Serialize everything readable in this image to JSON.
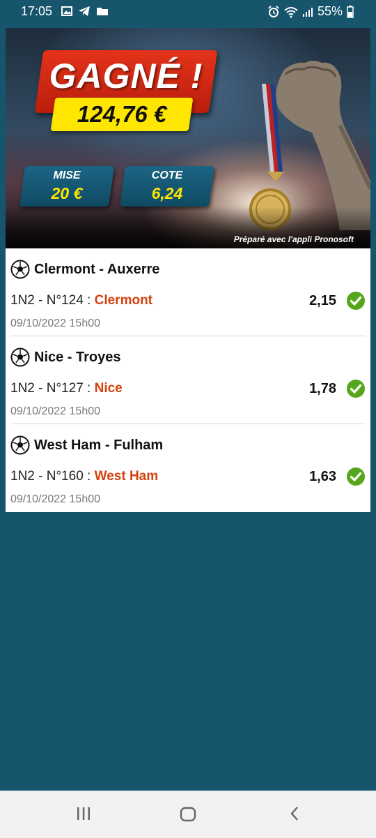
{
  "status_bar": {
    "time": "17:05",
    "battery_percent": "55%",
    "icons_left": [
      "gallery-icon",
      "telegram-icon",
      "folder-icon"
    ],
    "icons_right": [
      "alarm-icon",
      "wifi-icon",
      "signal-icon",
      "battery-icon"
    ]
  },
  "banner": {
    "headline": "GAGNÉ !",
    "amount": "124,76 €",
    "stake_label": "MISE",
    "stake_value": "20 €",
    "odds_label": "COTE",
    "odds_value": "6,24",
    "credit": "Préparé avec l'appli Pronosoft"
  },
  "matches": [
    {
      "title": "Clermont - Auxerre",
      "pick_prefix": "1N2 - N°124 : ",
      "pick_team": "Clermont",
      "odds": "2,15",
      "date": "09/10/2022 15h00",
      "status": "won"
    },
    {
      "title": "Nice - Troyes",
      "pick_prefix": "1N2 - N°127 : ",
      "pick_team": "Nice",
      "odds": "1,78",
      "date": "09/10/2022 15h00",
      "status": "won"
    },
    {
      "title": "West Ham - Fulham",
      "pick_prefix": "1N2 - N°160 : ",
      "pick_team": "West Ham",
      "odds": "1,63",
      "date": "09/10/2022 15h00",
      "status": "won"
    }
  ],
  "colors": {
    "background": "#17556d",
    "accent_team": "#d4410f",
    "check": "#56a51d",
    "headline_red": "#d62a12",
    "amount_yellow": "#ffe600"
  }
}
